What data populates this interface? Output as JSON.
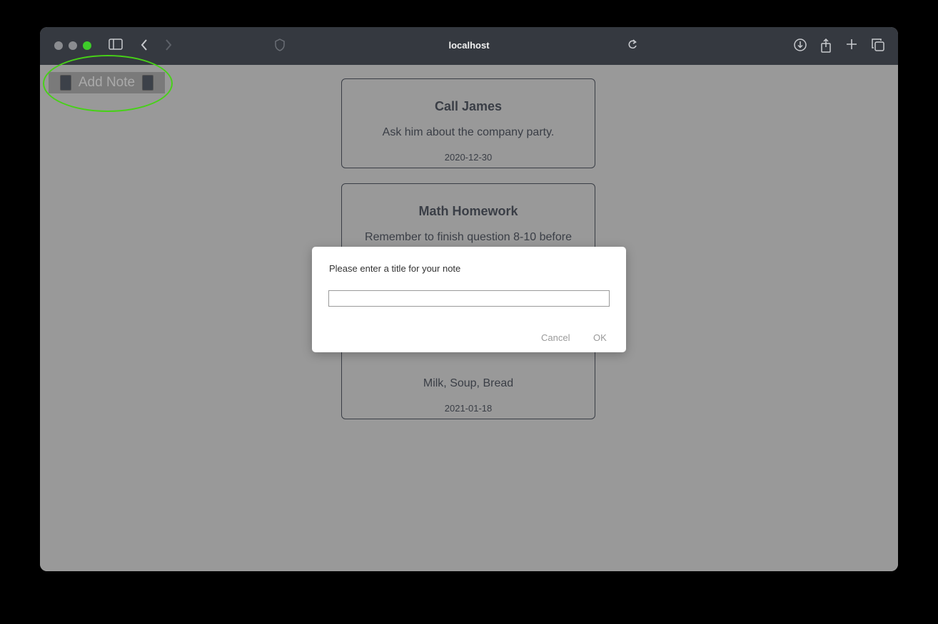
{
  "browser": {
    "url": "localhost"
  },
  "app": {
    "add_note_label": "Add Note"
  },
  "notes": [
    {
      "title": "Call James",
      "body": "Ask him about the company party.",
      "date": "2020-12-30"
    },
    {
      "title": "Math Homework",
      "body": "Remember to finish question 8-10 before",
      "date": ""
    },
    {
      "title": "",
      "body": "Milk, Soup, Bread",
      "date": "2021-01-18"
    }
  ],
  "dialog": {
    "message": "Please enter a title for your note",
    "input_value": "",
    "cancel_label": "Cancel",
    "ok_label": "OK"
  },
  "colors": {
    "annotation_ring": "#47d117",
    "traffic_light_active": "#3ecb2a"
  }
}
